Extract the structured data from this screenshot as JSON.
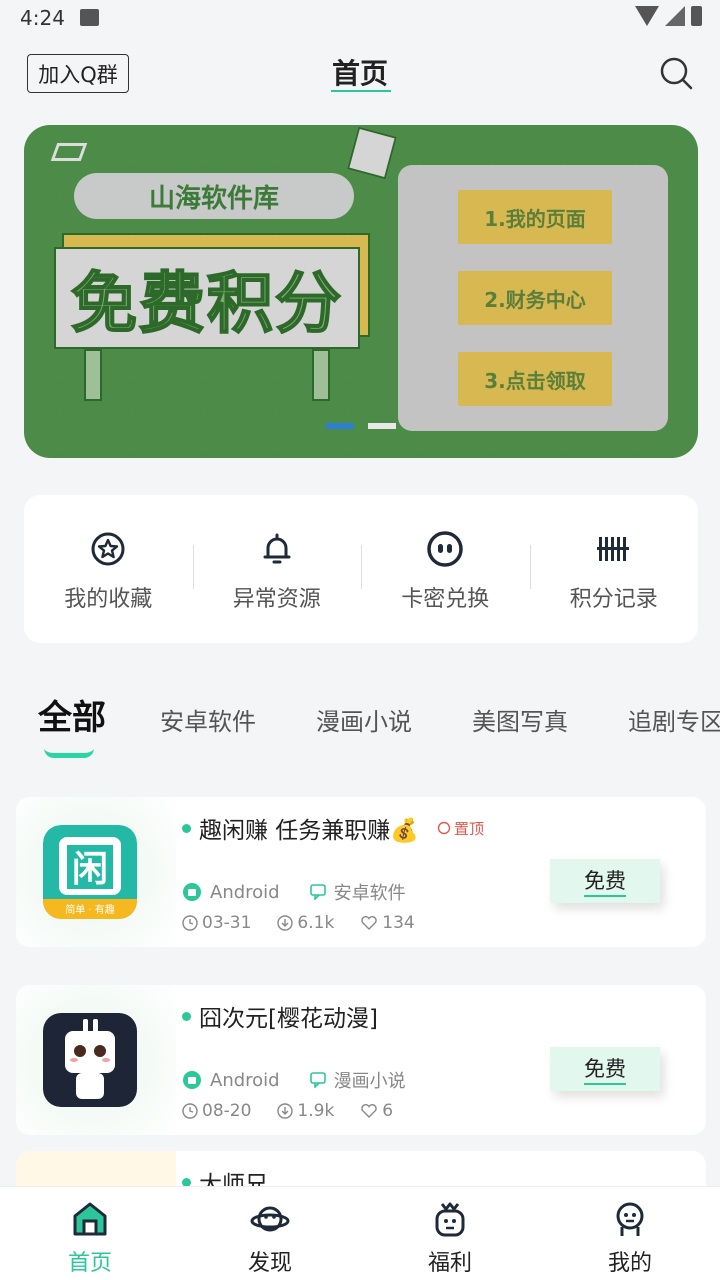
{
  "status_bar": {
    "time": "4:24"
  },
  "header": {
    "qq_button": "加入Q群",
    "title": "首页"
  },
  "banner": {
    "pill_text": "山海软件库",
    "board_text": "免费积分",
    "steps": [
      "1.我的页面",
      "2.财务中心",
      "3.点击领取"
    ],
    "page_count": 2,
    "active_page": 1
  },
  "shortcuts": [
    {
      "label": "我的收藏",
      "icon": "star-icon"
    },
    {
      "label": "异常资源",
      "icon": "bell-icon"
    },
    {
      "label": "卡密兑换",
      "icon": "face-icon"
    },
    {
      "label": "积分记录",
      "icon": "barcode-icon"
    }
  ],
  "categories": [
    "全部",
    "安卓软件",
    "漫画小说",
    "美图写真",
    "追剧专区"
  ],
  "active_category": "全部",
  "apps": [
    {
      "title": "趣闲赚 任务兼职赚💰",
      "pinned": "置顶",
      "platform": "Android",
      "category": "安卓软件",
      "date": "03-31",
      "downloads": "6.1k",
      "likes": "134",
      "price": "免费"
    },
    {
      "title": "囧次元[樱花动漫]",
      "pinned": "",
      "platform": "Android",
      "category": "漫画小说",
      "date": "08-20",
      "downloads": "1.9k",
      "likes": "6",
      "price": "免费"
    },
    {
      "title": "大师兄"
    }
  ],
  "tabbar": [
    {
      "label": "首页",
      "icon": "home-icon",
      "active": true
    },
    {
      "label": "发现",
      "icon": "planet-icon",
      "active": false
    },
    {
      "label": "福利",
      "icon": "gift-icon",
      "active": false
    },
    {
      "label": "我的",
      "icon": "user-icon",
      "active": false
    }
  ],
  "colors": {
    "accent": "#2bc79a",
    "banner_green": "#4d8c48",
    "gold": "#d8b851",
    "pin_red": "#e05a4e"
  }
}
